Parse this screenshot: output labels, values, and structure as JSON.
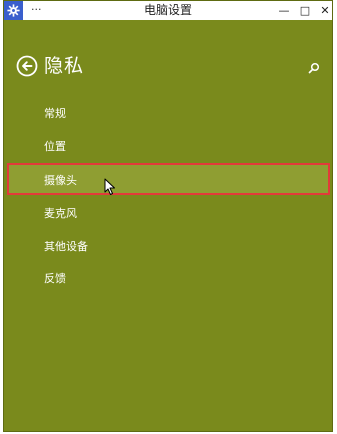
{
  "window": {
    "title": "电脑设置",
    "menu_glyph": "···",
    "minimize_glyph": "—",
    "maximize_glyph": "□",
    "close_glyph": "✕"
  },
  "header": {
    "title": "隐私",
    "back_icon": "back-arrow-circle-icon",
    "search_icon": "search-icon"
  },
  "nav": {
    "items": [
      {
        "label": "常规"
      },
      {
        "label": "位置"
      },
      {
        "label": "摄像头",
        "selected": true
      },
      {
        "label": "麦克风"
      },
      {
        "label": "其他设备"
      },
      {
        "label": "反馈"
      }
    ]
  },
  "colors": {
    "accent_background": "#7a8a1c",
    "selection_highlight": "#8f9e32",
    "annotation_border": "#e23a3a",
    "text": "#ffffff"
  }
}
